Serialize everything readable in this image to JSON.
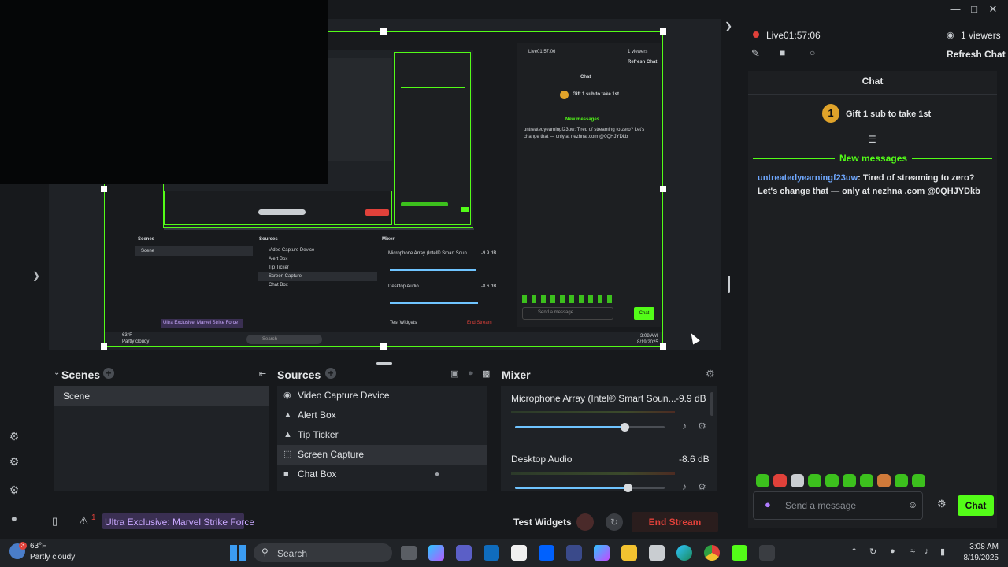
{
  "window": {
    "minimize_icon": "minimize-icon",
    "maximize_icon": "maximize-icon",
    "close_icon": "close-icon"
  },
  "stream": {
    "live_label": "Live01:57:06",
    "viewers": "1 viewers",
    "refresh": "Refresh Chat"
  },
  "chat": {
    "title": "Chat",
    "gift_badge": "1",
    "gift_text": "Gift 1 sub to take 1st",
    "new_messages": "New messages",
    "message_user": "untreatedyearningf23uw",
    "message_text": ": Tired of streaming to zero? Let's change that — only at nezhna .com @0QHJYDkb",
    "input_placeholder": "Send a message",
    "send_label": "Chat"
  },
  "docks": {
    "scenes_title": "Scenes",
    "scenes": [
      "Scene"
    ],
    "sources_title": "Sources",
    "sources": [
      {
        "label": "Video Capture Device",
        "icon": "camera-icon"
      },
      {
        "label": "Alert Box",
        "icon": "widget-icon"
      },
      {
        "label": "Tip Ticker",
        "icon": "widget-icon"
      },
      {
        "label": "Screen Capture",
        "icon": "screen-capture-icon"
      },
      {
        "label": "Chat Box",
        "icon": "chat-icon"
      }
    ],
    "mixer_title": "Mixer",
    "mixer": [
      {
        "name": "Microphone Array (Intel® Smart Soun...",
        "db": "-9.9 dB",
        "level": 0.73
      },
      {
        "name": "Desktop Audio",
        "db": "-8.6 dB",
        "level": 0.75
      }
    ]
  },
  "footer": {
    "alert_count": "1",
    "game": "Ultra Exclusive: Marvel Strike Force",
    "test_widgets": "Test Widgets",
    "end_stream": "End Stream"
  },
  "mini": {
    "live": "Live01:57:06",
    "viewers": "1 viewers",
    "refresh": "Refresh Chat",
    "chat": "Chat",
    "gift": "Gift 1 sub to take 1st",
    "new_messages": "New messages",
    "message": "untreatedyearningf23uw: Tired of streaming to zero? Let's change that — only at nezhna .com @0QHJYDkb",
    "send": "Send a message",
    "chat_btn": "Chat",
    "scenes": "Scenes",
    "scene": "Scene",
    "sources": "Sources",
    "mixer": "Mixer",
    "src": [
      "Video Capture Device",
      "Alert Box",
      "Tip Ticker",
      "Screen Capture",
      "Chat Box"
    ],
    "mic": "Microphone Array (Intel® Smart Soun...",
    "mic_db": "-9.9 dB",
    "desk": "Desktop Audio",
    "desk_db": "-8.6 dB",
    "game": "Ultra Exclusive: Marvel Strike Force",
    "test": "Test Widgets",
    "end": "End Stream",
    "weather": "63°F",
    "weather_desc": "Partly cloudy",
    "search": "Search",
    "time": "3:08 AM",
    "date": "8/19/2025"
  },
  "taskbar": {
    "weather_temp": "63°F",
    "weather_desc": "Partly cloudy",
    "weather_badge": "3",
    "search_placeholder": "Search",
    "time": "3:08 AM",
    "date": "8/19/2025"
  },
  "colors": {
    "accent": "#53fc18",
    "end_stream": "#e0413a",
    "game_tag": "#b07cff"
  }
}
